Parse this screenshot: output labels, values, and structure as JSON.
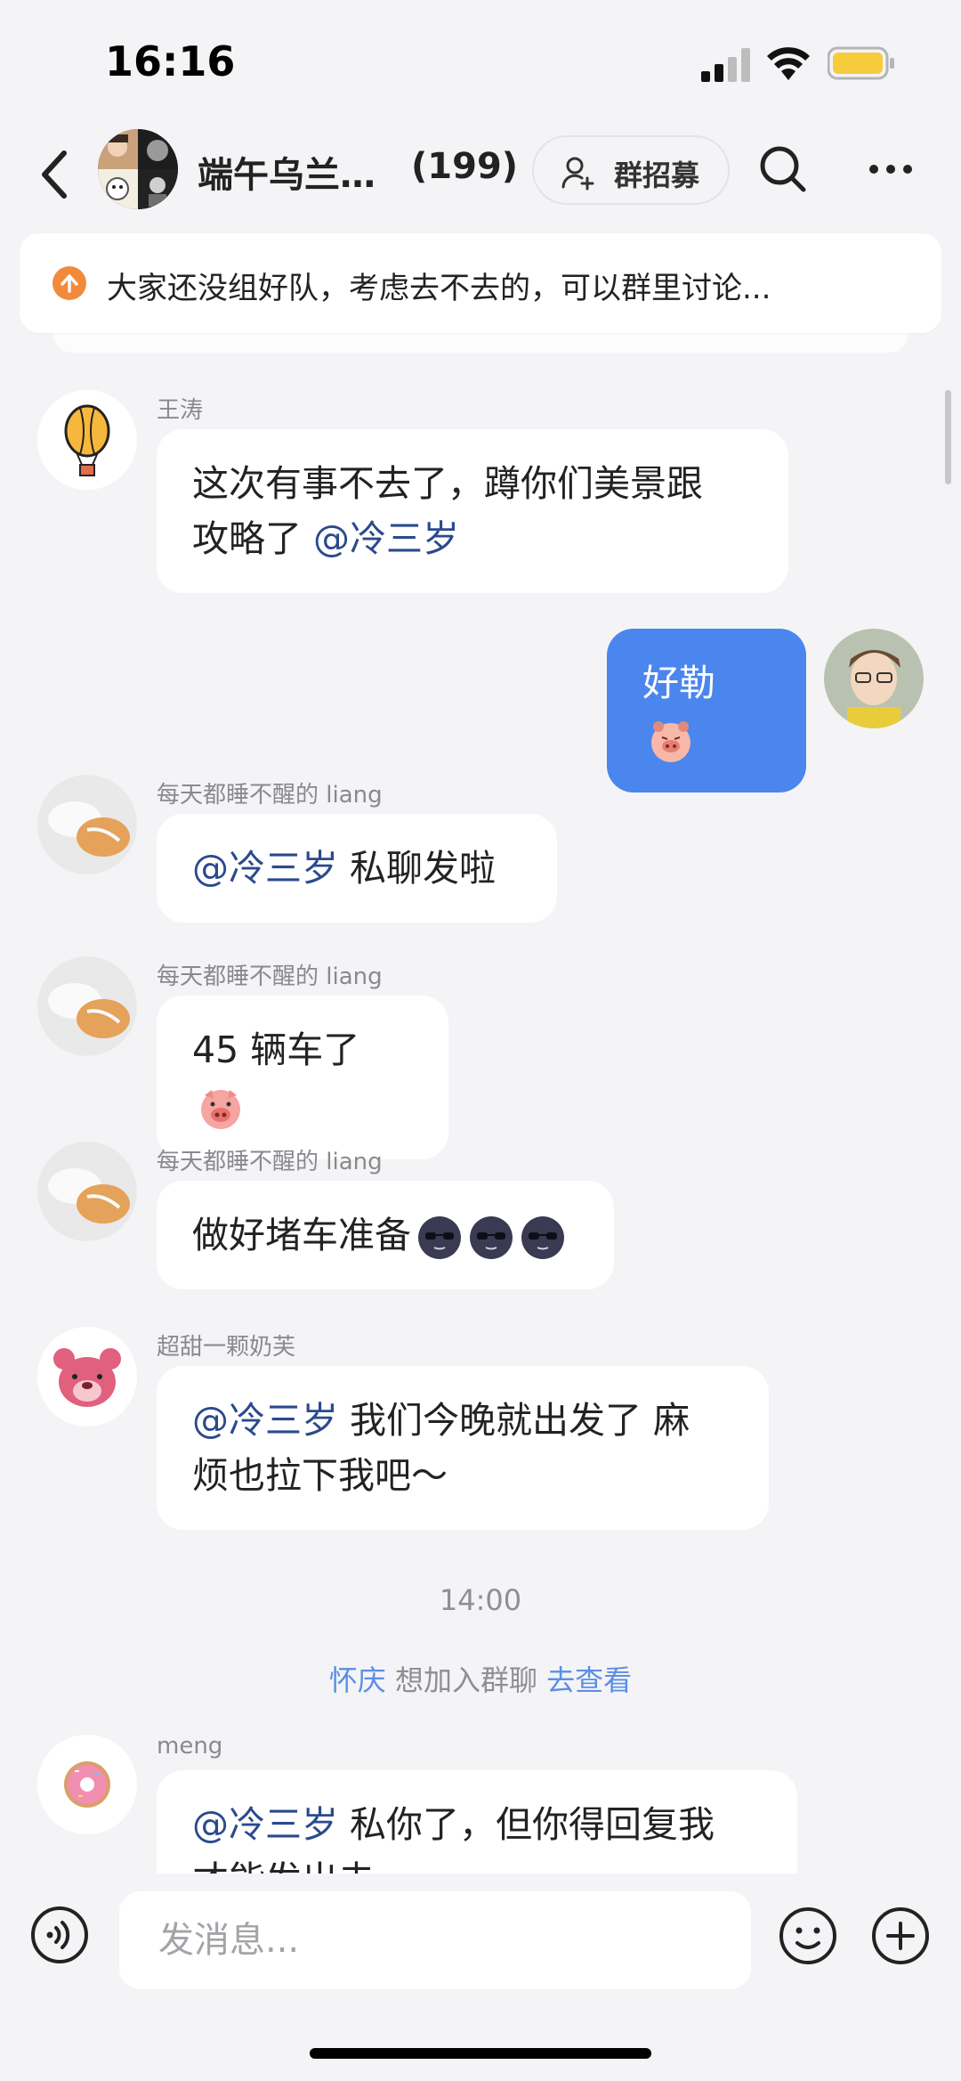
{
  "status_bar": {
    "time": "16:16"
  },
  "header": {
    "title": "端午乌兰…",
    "member_count": "(199)",
    "recruit_label": "群招募"
  },
  "announcement": {
    "text": "大家还没组好队，考虑去不去的，可以群里讨论..."
  },
  "messages": [
    {
      "sender": "王涛",
      "lines": [
        "这次有事不去了，蹲你们美景跟",
        "攻略了"
      ],
      "mention": "@冷三岁"
    },
    {
      "self_text": "好勒",
      "emoji": "pig-face-emoji"
    },
    {
      "sender": "每天都睡不醒的 liang",
      "mention": "@冷三岁",
      "text": " 私聊发啦"
    },
    {
      "sender": "每天都睡不醒的 liang",
      "text": "45 辆车了",
      "emoji": "pig-emoji"
    },
    {
      "sender": "每天都睡不醒的 liang",
      "text": "做好堵车准备",
      "emoji": "sunglasses-moon-emoji"
    },
    {
      "sender": "超甜一颗奶芙",
      "mention": "@冷三岁",
      "text": " 我们今晚就出发了 麻",
      "line2": "烦也拉下我吧～"
    },
    {
      "sender": "meng",
      "mention": "@冷三岁",
      "text": " 私你了，但你得回复我",
      "line2": "才能发出去"
    }
  ],
  "timestamp": "14:00",
  "system_notice": {
    "name": "怀庆",
    "middle": " 想加入群聊 ",
    "action": "去查看"
  },
  "input": {
    "placeholder": "发消息..."
  },
  "colors": {
    "accent_blue": "#4b86ee",
    "mention": "#2b4a8d",
    "link": "#5b8ee6",
    "background": "#f4f4f6"
  }
}
